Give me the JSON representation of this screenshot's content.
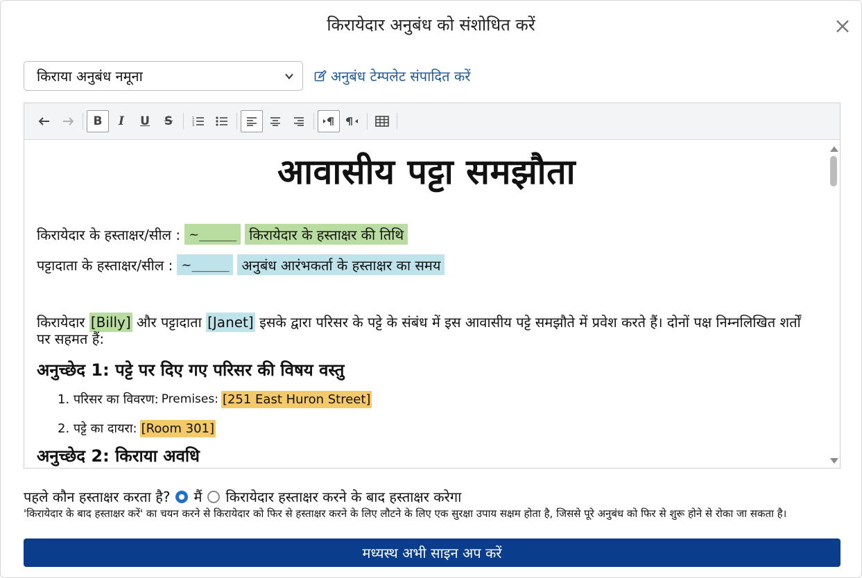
{
  "modal": {
    "title": "किरायेदार अनुबंध को संशोधित करें"
  },
  "template": {
    "selected": "किराया अनुबंध नमूना",
    "edit_link": "अनुबंध टेम्पलेट संपादित करें"
  },
  "toolbar": {
    "buttons": [
      "undo",
      "redo",
      "bold",
      "italic",
      "underline",
      "strikethrough",
      "ordered-list",
      "unordered-list",
      "align-left",
      "align-center",
      "align-right",
      "ltr",
      "rtl",
      "table"
    ],
    "bold_label": "B",
    "italic_label": "I",
    "underline_label": "U",
    "strike_label": "S"
  },
  "document": {
    "title": "आवासीय पट्टा समझौता",
    "tenant_sig_label": "किरायेदार के हस्ताक्षर/सील :",
    "tenant_sig_mark": "~______",
    "tenant_sig_date": "किरायेदार के हस्ताक्षर की तिथि",
    "landlord_sig_label": "पट्टादाता के हस्ताक्षर/सील :",
    "landlord_sig_mark": "~______",
    "landlord_sig_time": "अनुबंध आरंभकर्ता के हस्ताक्षर का समय",
    "intro_1": "किरायेदार",
    "tenant_name": "[Billy]",
    "intro_2": "और पट्टादाता",
    "landlord_name": "[Janet]",
    "intro_3": "इसके द्वारा परिसर के पट्टे के संबंध में इस आवासीय पट्टे समझौते में प्रवेश करते हैं। दोनों पक्ष निम्नलिखित शर्तों पर सहमत हैं:",
    "article1": "अनुच्छेद 1: पट्टे पर दिए गए परिसर की विषय वस्तु",
    "item1_label": "1. परिसर का विवरण:",
    "item1_prefix": "Premises:",
    "item1_value": "[251 East Huron Street]",
    "item2_label": "2. पट्टे का दायरा:",
    "item2_value": "[Room 301]",
    "article2": "अनुच्छेद 2: किराया अवधि"
  },
  "signing": {
    "question": "पहले कौन हस्ताक्षर करता है?",
    "option_me": "मैं",
    "option_tenant": "किरायेदार हस्ताक्षर करने के बाद हस्ताक्षर करेगा",
    "selected": "me",
    "note": "'किरायेदार के बाद हस्ताक्षर करें' का चयन करने से किरायेदार को फिर से हस्ताक्षर करने के लिए लौटने के लिए एक सुरक्षा उपाय सक्षम होता है, जिससे पूरे अनुबंध को फिर से शुरू होने से रोका जा सकता है।"
  },
  "submit": {
    "label": "मध्यस्थ अभी साइन अप करें"
  },
  "colors": {
    "primary_button": "#0b3d8d",
    "link": "#1f5a96",
    "tenant_highlight": "#b9dca0",
    "landlord_highlight": "#bfe3ea",
    "field_highlight": "#f4c96a"
  }
}
